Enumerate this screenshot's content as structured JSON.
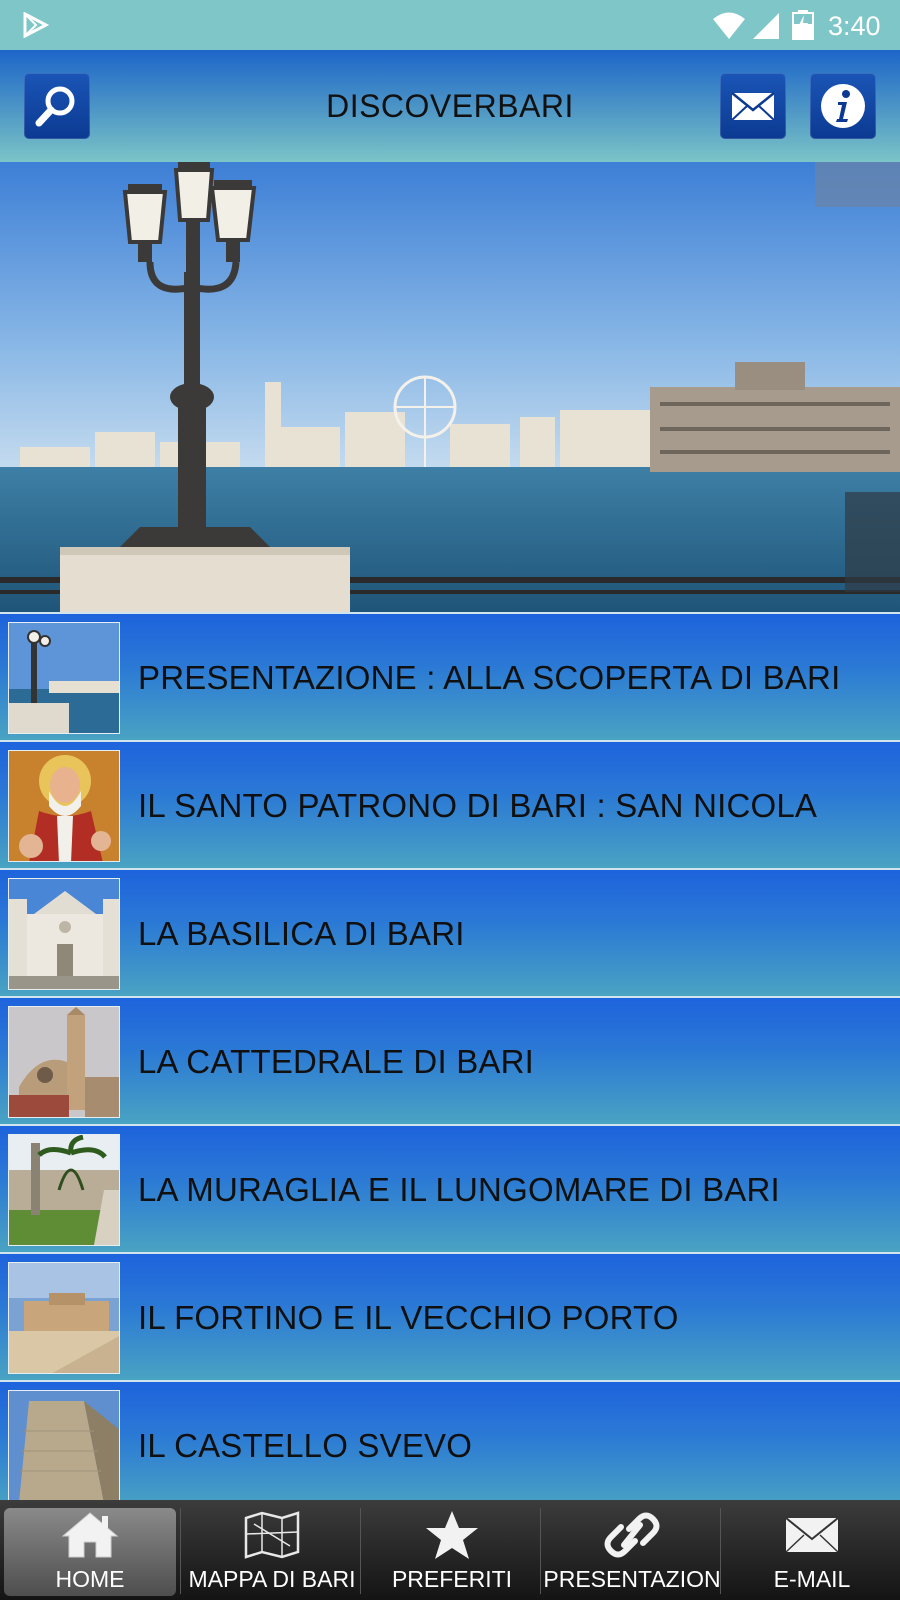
{
  "status_bar": {
    "time": "3:40",
    "icons": [
      "play-store-icon",
      "wifi-icon",
      "cellular-icon",
      "battery-icon"
    ]
  },
  "header": {
    "title": "DISCOVERBARI",
    "left_button_icon": "search-icon",
    "right_button_icons": [
      "mail-icon",
      "info-icon"
    ],
    "accent_color": "#0c3a92"
  },
  "hero": {
    "image": "waterfront-lamppost-photo"
  },
  "list": {
    "items": [
      {
        "label": "PRESENTAZIONE : ALLA SCOPERTA DI BARI",
        "thumb": "lamppost-waterfront-thumb"
      },
      {
        "label": "IL SANTO PATRONO DI BARI : SAN NICOLA",
        "thumb": "saint-nicholas-icon-thumb"
      },
      {
        "label": "LA BASILICA DI BARI",
        "thumb": "basilica-thumb"
      },
      {
        "label": "LA CATTEDRALE DI BARI",
        "thumb": "cathedral-thumb"
      },
      {
        "label": "LA MURAGLIA E IL LUNGOMARE DI BARI",
        "thumb": "wall-promenade-thumb"
      },
      {
        "label": "IL FORTINO E IL VECCHIO PORTO",
        "thumb": "fortino-thumb"
      },
      {
        "label": "IL CASTELLO SVEVO",
        "thumb": "castle-thumb"
      }
    ]
  },
  "bottom_nav": {
    "items": [
      {
        "label": "HOME",
        "icon": "home-icon",
        "active": true
      },
      {
        "label": "MAPPA DI BARI",
        "icon": "map-icon",
        "active": false
      },
      {
        "label": "PREFERITI",
        "icon": "star-icon",
        "active": false
      },
      {
        "label": "PRESENTAZION",
        "icon": "link-icon",
        "active": false
      },
      {
        "label": "E-MAIL",
        "icon": "mail-icon",
        "active": false
      }
    ]
  }
}
